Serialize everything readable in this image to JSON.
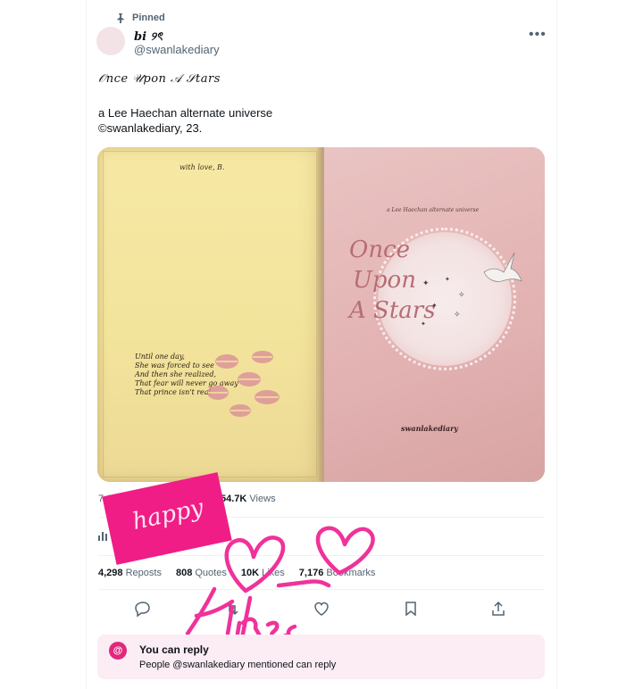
{
  "post": {
    "pinned_label": "Pinned",
    "author_name": "bi ୨ৎ",
    "author_handle": "@swanlakediary",
    "text_line1": "𝒪nce 𝒰pon 𝒜 𝒮tars",
    "text_line2": "a Lee Haechan alternate universe",
    "text_line3": "©swanlakediary, 23.",
    "time": "7:14 PM",
    "views_count": "54.7K",
    "views_label": "Views",
    "reposts_count": "4,298",
    "reposts_label": "Reposts",
    "quotes_count": "808",
    "quotes_label": "Quotes",
    "likes_count": "10K",
    "likes_label": "Likes",
    "bookmarks_count": "7,176",
    "bookmarks_label": "Bookmarks"
  },
  "image": {
    "left_page": {
      "dedication": "with love, B.",
      "poem": [
        "Until one day,",
        "She was forced to see",
        "And then she realized,",
        "That fear will never go away",
        "That prince isn't real"
      ]
    },
    "right_page": {
      "subtitle": "a Lee Haechan alternate universe",
      "title_lines": [
        "Once",
        "Upon",
        "A Stars"
      ],
      "author": "swanlakediary"
    }
  },
  "overlay": {
    "sticker_text": "happy",
    "scribble_text": "likes"
  },
  "reply": {
    "icon": "@",
    "title": "You can reply",
    "subtitle": "People @swanlakediary mentioned can reply"
  },
  "icons": {
    "pin": "pin-icon",
    "more": "more-icon",
    "analytics": "analytics-icon",
    "reply": "reply-icon",
    "repost": "repost-icon",
    "like": "heart-icon",
    "bookmark": "bookmark-icon",
    "share": "share-icon"
  },
  "colors": {
    "accent_pink": "#f01d86",
    "reply_bg": "#fcecf4",
    "muted_text": "#536471"
  }
}
